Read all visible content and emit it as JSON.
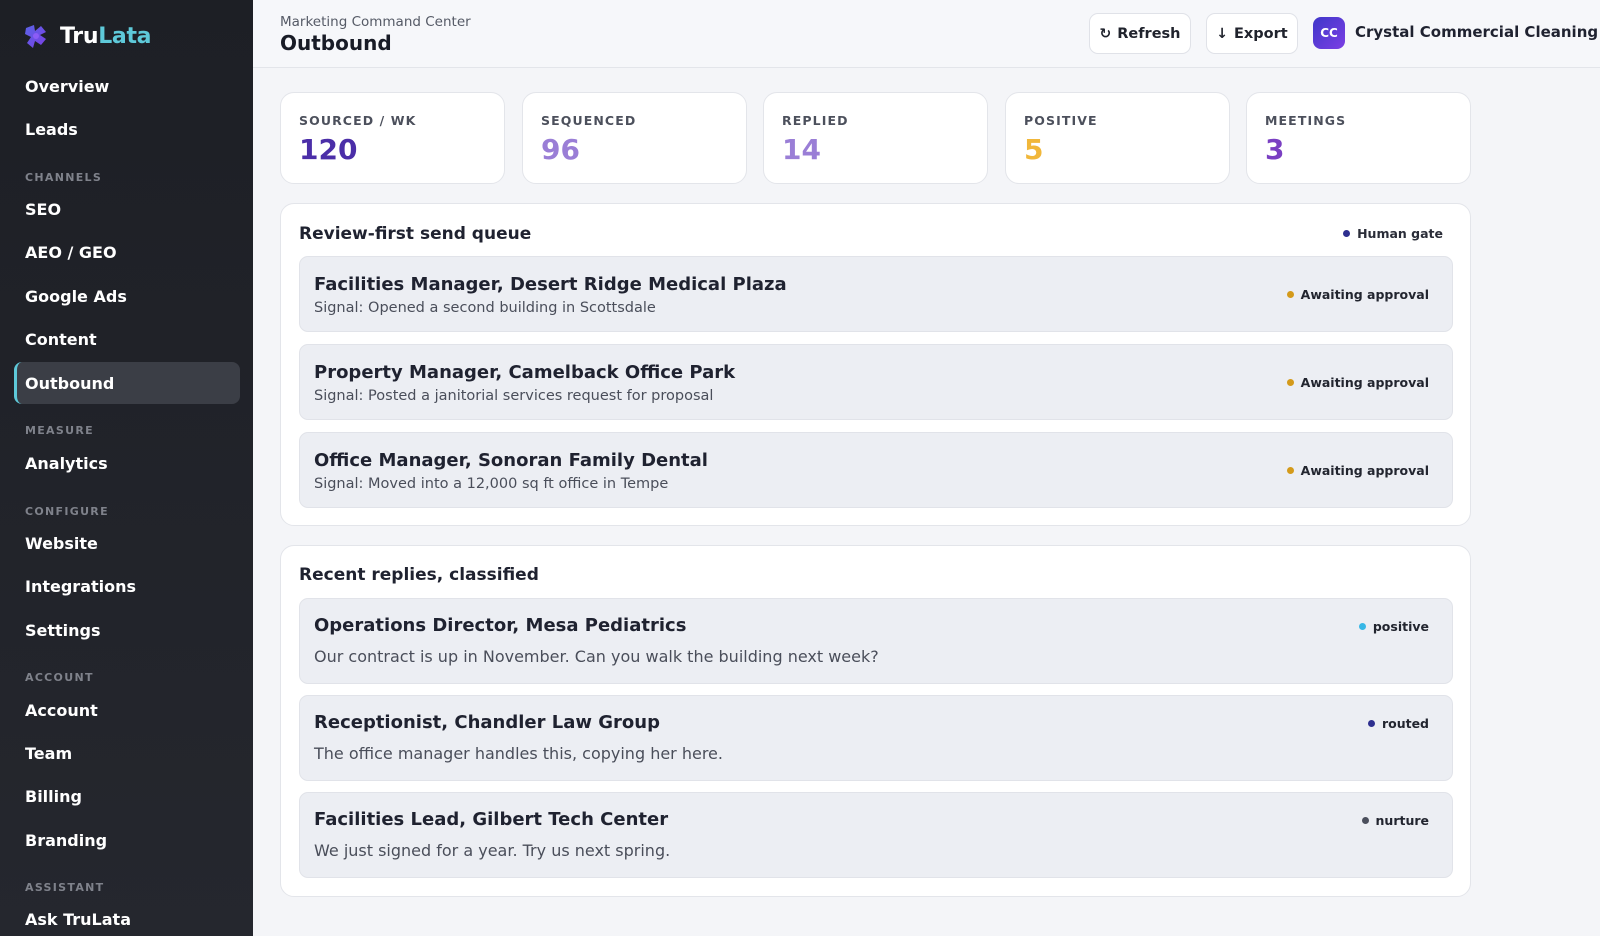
{
  "brand": {
    "name_part1": "Tru",
    "name_part2": "Lata",
    "logo_icon": "puzzle-mark-icon"
  },
  "colors": {
    "accent_teal": "#5ec9d9",
    "brand_purple": "#4b2ea8",
    "status_awaiting": "#d49a1a",
    "status_positive": "#37b7e6",
    "status_routed": "#2e2f8f",
    "status_nurture": "#4b4f5c"
  },
  "sidebar": {
    "items": [
      {
        "label": "Overview"
      },
      {
        "label": "Leads"
      }
    ],
    "sections": [
      {
        "title": "CHANNELS",
        "items": [
          {
            "label": "SEO"
          },
          {
            "label": "AEO / GEO"
          },
          {
            "label": "Google Ads"
          },
          {
            "label": "Content"
          },
          {
            "label": "Outbound",
            "active": true
          }
        ]
      },
      {
        "title": "MEASURE",
        "items": [
          {
            "label": "Analytics"
          }
        ]
      },
      {
        "title": "CONFIGURE",
        "items": [
          {
            "label": "Website"
          },
          {
            "label": "Integrations"
          },
          {
            "label": "Settings"
          }
        ]
      },
      {
        "title": "ACCOUNT",
        "items": [
          {
            "label": "Account"
          },
          {
            "label": "Team"
          },
          {
            "label": "Billing"
          },
          {
            "label": "Branding"
          }
        ]
      },
      {
        "title": "ASSISTANT",
        "items": [
          {
            "label": "Ask TruLata"
          }
        ]
      }
    ]
  },
  "header": {
    "breadcrumb": "Marketing Command Center",
    "title": "Outbound",
    "refresh_label": "Refresh",
    "refresh_icon": "↻",
    "export_label": "Export",
    "export_icon": "↓",
    "avatar_initials": "CC",
    "account_name": "Crystal Commercial Cleaning"
  },
  "kpis": [
    {
      "label": "SOURCED / WK",
      "value": "120",
      "color": "#4b2ea8"
    },
    {
      "label": "SEQUENCED",
      "value": "96",
      "color": "#9a7ed6"
    },
    {
      "label": "REPLIED",
      "value": "14",
      "color": "#9a7ed6"
    },
    {
      "label": "POSITIVE",
      "value": "5",
      "color": "#f1b73a"
    },
    {
      "label": "MEETINGS",
      "value": "3",
      "color": "#7a3fc2"
    }
  ],
  "send_queue": {
    "title": "Review-first send queue",
    "gate_label": "Human gate",
    "items": [
      {
        "title": "Facilities Manager, Desert Ridge Medical Plaza",
        "signal": "Signal: Opened a second building in Scottsdale",
        "status": "Awaiting approval"
      },
      {
        "title": "Property Manager, Camelback Office Park",
        "signal": "Signal: Posted a janitorial services request for proposal",
        "status": "Awaiting approval"
      },
      {
        "title": "Office Manager, Sonoran Family Dental",
        "signal": "Signal: Moved into a 12,000 sq ft office in Tempe",
        "status": "Awaiting approval"
      }
    ]
  },
  "replies": {
    "title": "Recent replies, classified",
    "items": [
      {
        "title": "Operations Director, Mesa Pediatrics",
        "message": "Our contract is up in November. Can you walk the building next week?",
        "status": "positive"
      },
      {
        "title": "Receptionist, Chandler Law Group",
        "message": "The office manager handles this, copying her here.",
        "status": "routed"
      },
      {
        "title": "Facilities Lead, Gilbert Tech Center",
        "message": "We just signed for a year. Try us next spring.",
        "status": "nurture"
      }
    ]
  }
}
